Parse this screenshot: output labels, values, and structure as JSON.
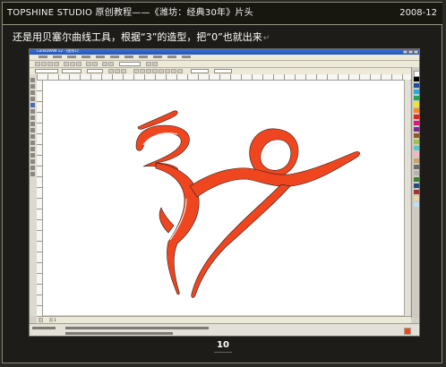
{
  "header": {
    "title": "TOPSHINE STUDIO 原创教程——《潍坊：经典30年》片头",
    "date": "2008-12"
  },
  "caption": {
    "text": "还是用贝塞尔曲线工具，根据“3”的造型，把“0”也就出来",
    "mark": "↵"
  },
  "app": {
    "window_title": "CorelDRAW 12 - [图形1]",
    "active_tool": "bezier-tool-icon",
    "page_tab": "页 1",
    "artwork_fill": "#f0461f",
    "artwork_outline": "#1f1f1f",
    "artwork_highlight": "#f8f0ea"
  },
  "footer": {
    "page_number": "10"
  }
}
